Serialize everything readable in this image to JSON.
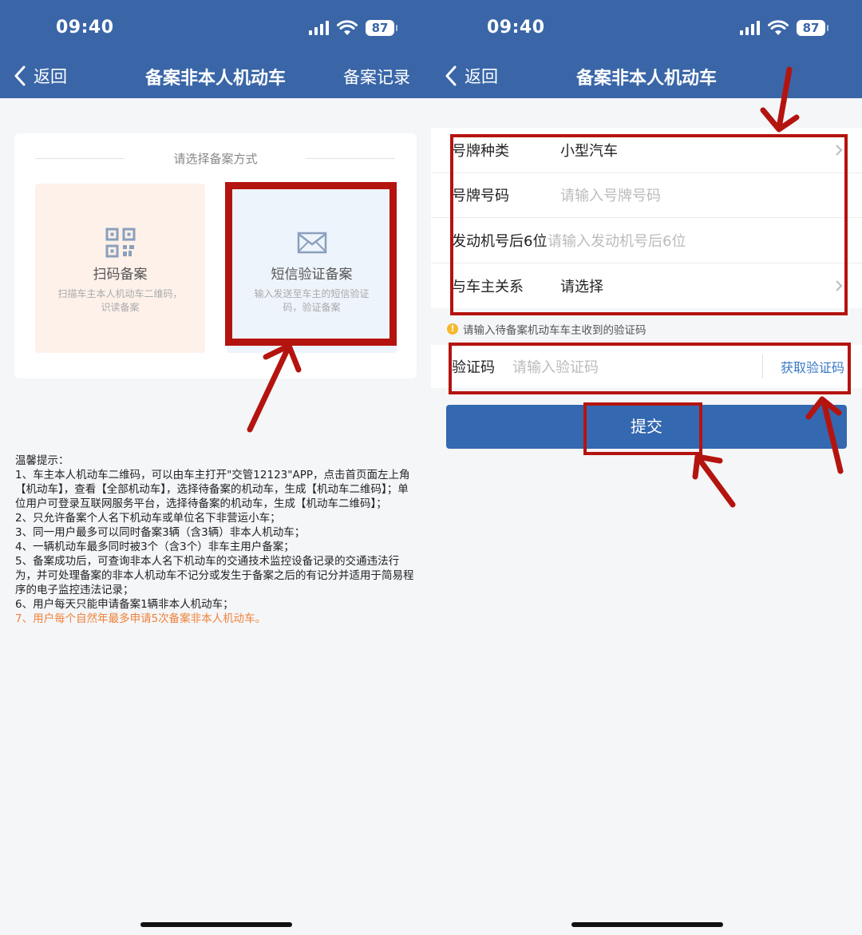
{
  "status_bar": {
    "time": "09:40",
    "battery": "87"
  },
  "left_screen": {
    "nav": {
      "back_label": "返回",
      "title": "备案非本人机动车",
      "right_label": "备案记录"
    },
    "method_card": {
      "title": "请选择备案方式",
      "options": [
        {
          "label": "扫码备案",
          "desc": "扫描车主本人机动车二维码，识读备案",
          "icon": "qr-code-icon"
        },
        {
          "label": "短信验证备案",
          "desc": "输入发送至车主的短信验证码，验证备案",
          "icon": "envelope-icon"
        }
      ]
    },
    "tips": {
      "heading": "温馨提示：",
      "lines": [
        "1、车主本人机动车二维码，可以由车主打开\"交管12123\"APP，点击首页面左上角【机动车】，查看【全部机动车】，选择待备案的机动车，生成【机动车二维码】；单位用户可登录互联网服务平台，选择待备案的机动车，生成【机动车二维码】；",
        "2、只允许备案个人名下机动车或单位名下非营运小车；",
        "3、同一用户最多可以同时备案3辆（含3辆）非本人机动车；",
        "4、一辆机动车最多同时被3个（含3个）非车主用户备案；",
        "5、备案成功后，可查询非本人名下机动车的交通技术监控设备记录的交通违法行为，并可处理备案的非本人机动车不记分或发生于备案之后的有记分并适用于简易程序的电子监控违法记录；",
        "6、用户每天只能申请备案1辆非本人机动车；"
      ],
      "highlight": "7、用户每个自然年最多申请5次备案非本人机动车。"
    }
  },
  "right_screen": {
    "nav": {
      "back_label": "返回",
      "title": "备案非本人机动车"
    },
    "form": {
      "rows": [
        {
          "label": "号牌种类",
          "value": "小型汽车",
          "placeholder": false,
          "arrow": true
        },
        {
          "label": "号牌号码",
          "value": "请输入号牌号码",
          "placeholder": true,
          "arrow": false
        },
        {
          "label": "发动机号后6位",
          "value": "请输入发动机号后6位",
          "placeholder": true,
          "arrow": false
        },
        {
          "label": "与车主关系",
          "value": "请选择",
          "placeholder": false,
          "arrow": true
        }
      ]
    },
    "hint": "请输入待备案机动车车主收到的验证码",
    "code": {
      "label": "验证码",
      "placeholder": "请输入验证码",
      "get_code": "获取验证码"
    },
    "submit": "提交"
  },
  "colors": {
    "header": "#3a66a8",
    "annotation": "#b4140f",
    "highlight": "#f0823a",
    "link": "#3a78c6"
  }
}
